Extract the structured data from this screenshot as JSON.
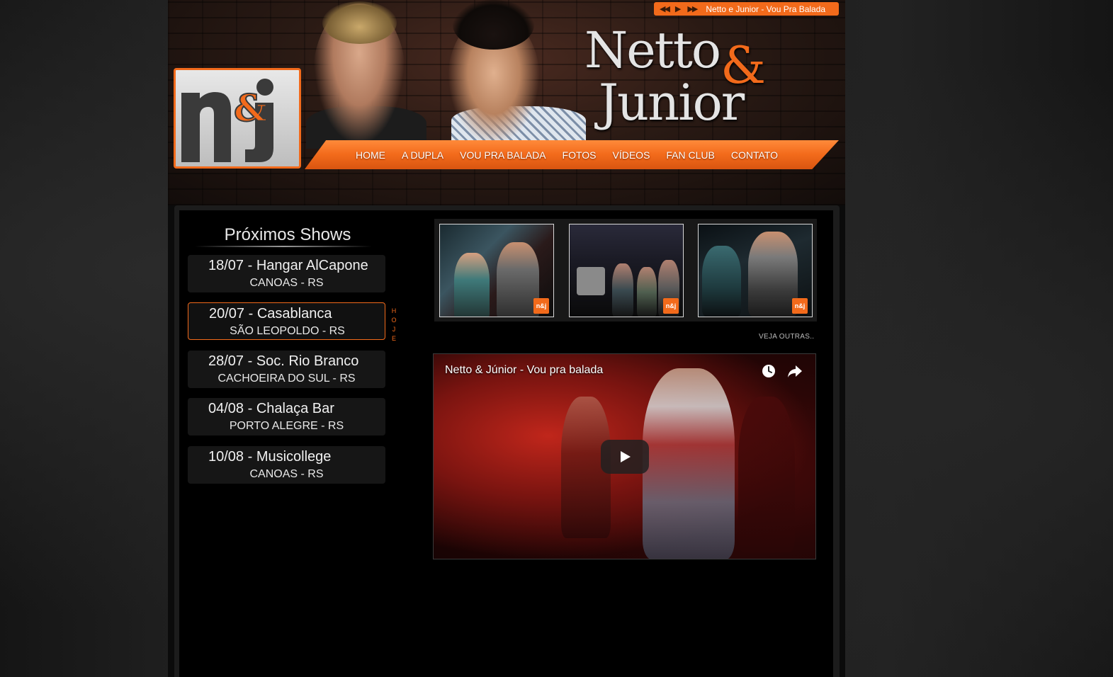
{
  "player": {
    "prev_icon": "rewind-icon",
    "play_icon": "play-icon",
    "next_icon": "fast-forward-icon",
    "now_playing": "Netto e Junior - Vou Pra Balada"
  },
  "brand": {
    "logo_text": "n&j",
    "name_line1": "Netto",
    "ampersand": "&",
    "name_line2": "Junior"
  },
  "nav": {
    "items": [
      "HOME",
      "A DUPLA",
      "VOU PRA BALADA",
      "FOTOS",
      "VÍDEOS",
      "FAN CLUB",
      "CONTATO"
    ]
  },
  "shows": {
    "title": "Próximos Shows",
    "today_label": [
      "H",
      "O",
      "J",
      "E"
    ],
    "items": [
      {
        "title": "18/07 - Hangar AlCapone",
        "city": "CANOAS - RS"
      },
      {
        "title": "20/07 - Casablanca",
        "city": "SÃO LEOPOLDO - RS"
      },
      {
        "title": "28/07 - Soc. Rio Branco",
        "city": "CACHOEIRA DO SUL - RS"
      },
      {
        "title": "04/08 - Chalaça Bar",
        "city": "PORTO ALEGRE - RS"
      },
      {
        "title": "10/08 - Musicollege",
        "city": "CANOAS - RS"
      }
    ]
  },
  "gallery": {
    "see_more": "VEJA OUTRAS..",
    "thumb_watermark": "n&j"
  },
  "video": {
    "title": "Netto & Júnior - Vou pra balada",
    "watch_later_icon": "clock-icon",
    "share_icon": "share-arrow-icon",
    "play_icon": "play-icon"
  },
  "colors": {
    "accent": "#f26a1b",
    "background": "#000000"
  }
}
